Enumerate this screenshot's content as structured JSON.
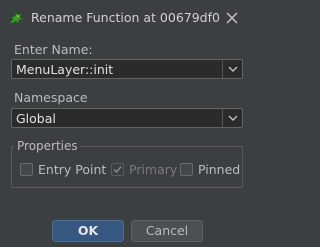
{
  "window": {
    "title": "Rename Function at 00679df0",
    "icon": "dragon-icon"
  },
  "name_field": {
    "label": "Enter Name:",
    "value": "MenuLayer::init"
  },
  "namespace_field": {
    "label": "Namespace",
    "value": "Global"
  },
  "properties": {
    "title": "Properties",
    "checkboxes": [
      {
        "label": "Entry Point",
        "checked": false,
        "enabled": true
      },
      {
        "label": "Primary",
        "checked": true,
        "enabled": false
      },
      {
        "label": "Pinned",
        "checked": false,
        "enabled": true
      }
    ]
  },
  "buttons": {
    "ok": "OK",
    "cancel": "Cancel"
  },
  "colors": {
    "background": "#3c3f41",
    "field_background": "#2b2b2b",
    "ok_button": "#365880"
  }
}
